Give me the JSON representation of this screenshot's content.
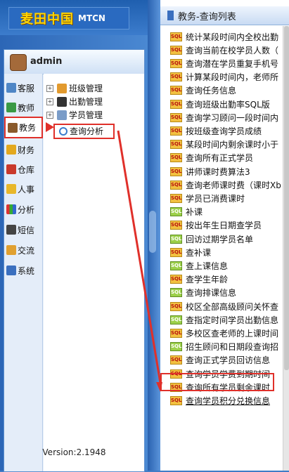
{
  "header": {
    "logo_text": "麦田中国",
    "logo_sub": "MTCN"
  },
  "user": {
    "name": "admin"
  },
  "nav": [
    {
      "label": "客服",
      "icon": "customer-service-icon"
    },
    {
      "label": "教师",
      "icon": "teacher-icon"
    },
    {
      "label": "教务",
      "icon": "academic-icon"
    },
    {
      "label": "财务",
      "icon": "finance-icon"
    },
    {
      "label": "仓库",
      "icon": "warehouse-icon"
    },
    {
      "label": "人事",
      "icon": "hr-icon"
    },
    {
      "label": "分析",
      "icon": "chart-icon"
    },
    {
      "label": "短信",
      "icon": "sms-icon"
    },
    {
      "label": "交流",
      "icon": "chat-icon"
    },
    {
      "label": "系统",
      "icon": "system-icon"
    }
  ],
  "tree": [
    {
      "label": "班级管理"
    },
    {
      "label": "出勤管理"
    },
    {
      "label": "学员管理"
    },
    {
      "label": "查询分析"
    }
  ],
  "version": "Version:2.1948",
  "list_title": "教务-查询列表",
  "items": [
    "统计某段时间内全校出勤",
    "查询当前在校学员人数（",
    "查询潜在学员重复手机号",
    "计算某段时间内，老师所",
    "查询任务信息",
    "查询班级出勤率SQL版",
    "查询学习顾问一段时间内",
    "按班级查询学员成绩",
    "某段时间内剩余课时小于",
    "查询所有正式学员",
    "讲师课时费算法3",
    "查询老师课时费（课时Xb",
    "学员已消费课时",
    "补课",
    "按出年生日期查学员",
    "回访过期学员名单",
    "查补课",
    "查上课信息",
    "查学生年龄",
    "查询排课信息",
    "校区全部高级顾问关怀查",
    "查指定时间学员出勤信息",
    "多校区查老师的上课时间",
    "招生顾问和日期段查询招",
    "查询正式学员回访信息",
    "查询学员学费到期时间",
    "查询所有学员剩余课时",
    "查询学员积分兑换信息"
  ]
}
